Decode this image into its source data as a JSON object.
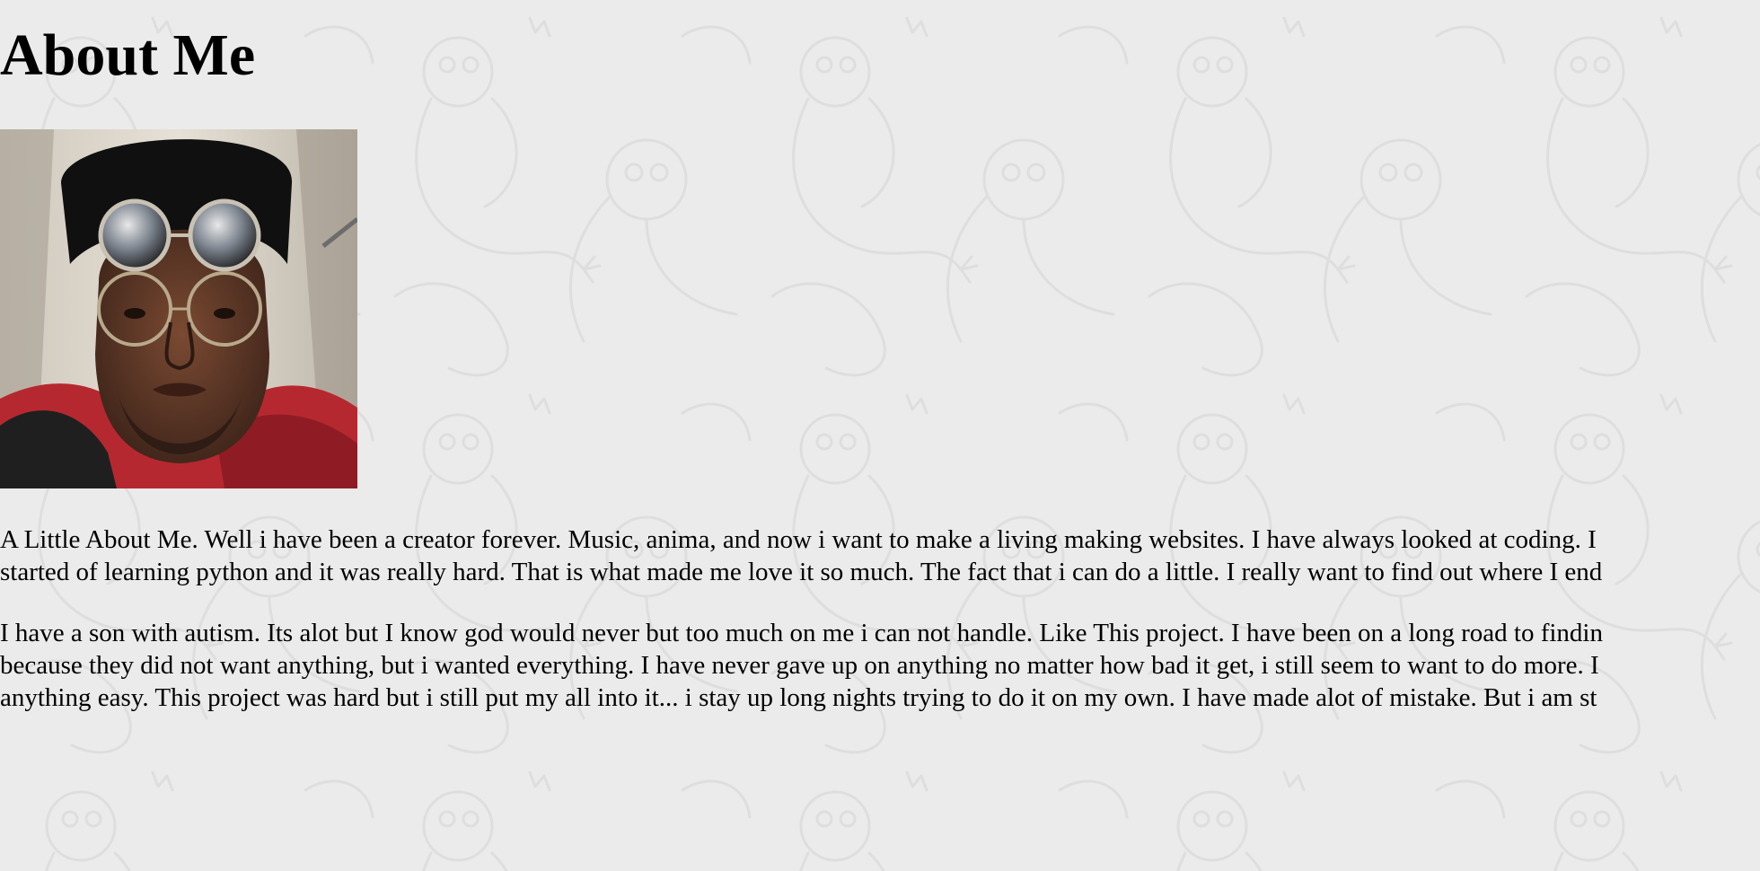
{
  "page": {
    "title": "About Me"
  },
  "profile_photo": {
    "alt": "profile photo"
  },
  "paragraphs": [
    {
      "lines": [
        "A Little About Me. Well i have been a creator forever. Music, anima, and now i want to make a living making websites. I have always looked at coding. I",
        "started of learning python and it was really hard. That is what made me love it so much. The fact that i can do a little. I really want to find out where I end"
      ]
    },
    {
      "lines": [
        "I have a son with autism. Its alot but I know god would never but too much on me i can not handle. Like This project. I have been on a long road to findin",
        "because they did not want anything, but i wanted everything. I have never gave up on anything no matter how bad it get, i still seem to want to do more. I",
        "anything easy. This project was hard but i still put my all into it... i stay up long nights trying to do it on my own. I have made alot of mistake. But i am st"
      ]
    }
  ],
  "colors": {
    "background": "#ebebeb",
    "pattern_stroke": "#dedede",
    "text": "#000000"
  }
}
